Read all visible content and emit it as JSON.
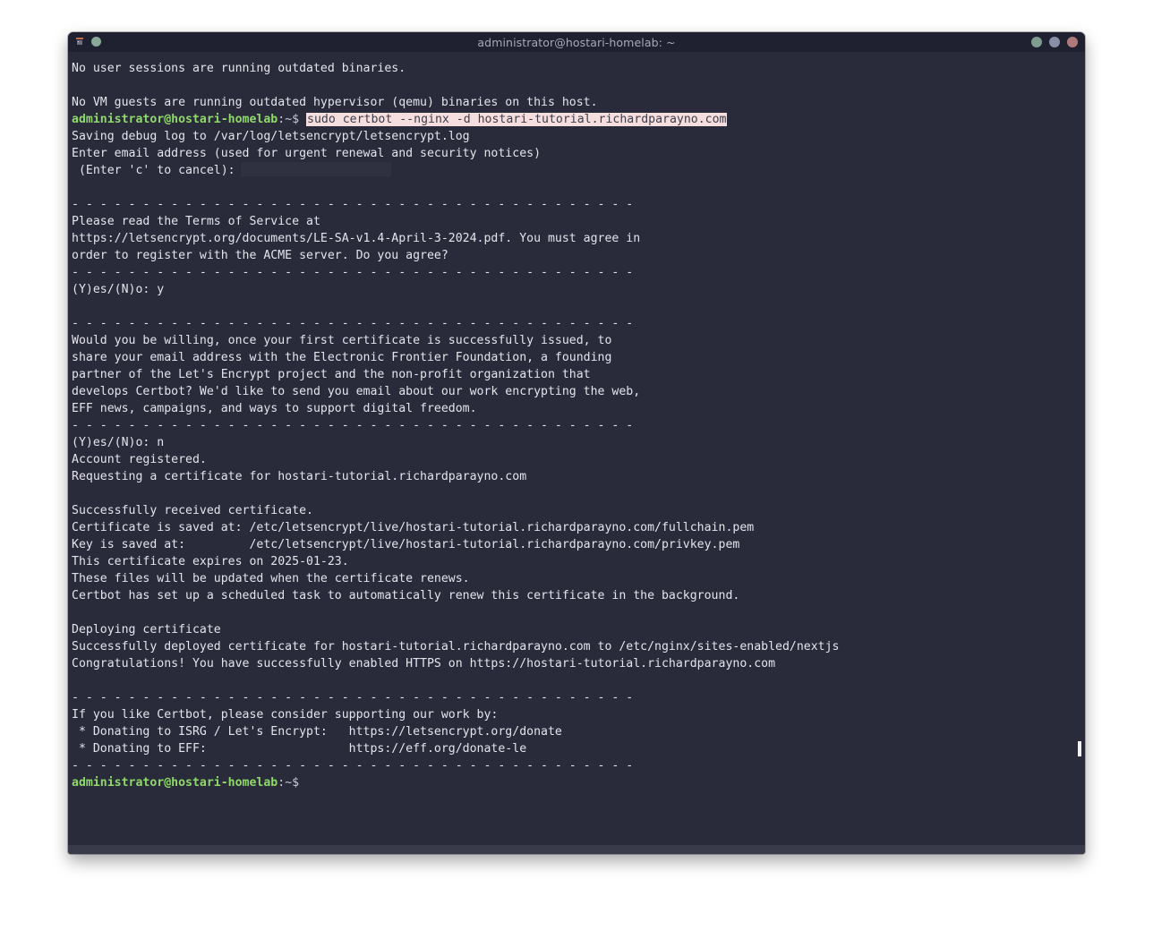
{
  "window": {
    "title": "administrator@hostari-homelab: ~"
  },
  "prompt": {
    "user_host": "administrator@hostari-homelab",
    "suffix": ":~$"
  },
  "colors": {
    "prompt_green": "#8fd96b",
    "terminal_bg": "#2a2b3a",
    "highlight_bg": "#f6dede"
  },
  "terminal": {
    "lines": [
      {
        "t": "No user sessions are running outdated binaries."
      },
      {
        "t": ""
      },
      {
        "t": "No VM guests are running outdated hypervisor (qemu) binaries on this host."
      },
      {
        "type": "prompt",
        "cmd": "sudo certbot --nginx -d hostari-tutorial.richardparayno.com"
      },
      {
        "t": "Saving debug log to /var/log/letsencrypt/letsencrypt.log"
      },
      {
        "t": "Enter email address (used for urgent renewal and security notices)"
      },
      {
        "type": "redacted",
        "t": " (Enter 'c' to cancel):"
      },
      {
        "t": ""
      },
      {
        "t": "- - - - - - - - - - - - - - - - - - - - - - - - - - - - - - - - - - - - - - - -"
      },
      {
        "t": "Please read the Terms of Service at"
      },
      {
        "t": "https://letsencrypt.org/documents/LE-SA-v1.4-April-3-2024.pdf. You must agree in"
      },
      {
        "t": "order to register with the ACME server. Do you agree?"
      },
      {
        "t": "- - - - - - - - - - - - - - - - - - - - - - - - - - - - - - - - - - - - - - - -"
      },
      {
        "t": "(Y)es/(N)o: y"
      },
      {
        "t": ""
      },
      {
        "t": "- - - - - - - - - - - - - - - - - - - - - - - - - - - - - - - - - - - - - - - -"
      },
      {
        "t": "Would you be willing, once your first certificate is successfully issued, to"
      },
      {
        "t": "share your email address with the Electronic Frontier Foundation, a founding"
      },
      {
        "t": "partner of the Let's Encrypt project and the non-profit organization that"
      },
      {
        "t": "develops Certbot? We'd like to send you email about our work encrypting the web,"
      },
      {
        "t": "EFF news, campaigns, and ways to support digital freedom."
      },
      {
        "t": "- - - - - - - - - - - - - - - - - - - - - - - - - - - - - - - - - - - - - - - -"
      },
      {
        "t": "(Y)es/(N)o: n"
      },
      {
        "t": "Account registered."
      },
      {
        "t": "Requesting a certificate for hostari-tutorial.richardparayno.com"
      },
      {
        "t": ""
      },
      {
        "t": "Successfully received certificate."
      },
      {
        "t": "Certificate is saved at: /etc/letsencrypt/live/hostari-tutorial.richardparayno.com/fullchain.pem"
      },
      {
        "t": "Key is saved at:         /etc/letsencrypt/live/hostari-tutorial.richardparayno.com/privkey.pem"
      },
      {
        "t": "This certificate expires on 2025-01-23."
      },
      {
        "t": "These files will be updated when the certificate renews."
      },
      {
        "t": "Certbot has set up a scheduled task to automatically renew this certificate in the background."
      },
      {
        "t": ""
      },
      {
        "t": "Deploying certificate"
      },
      {
        "t": "Successfully deployed certificate for hostari-tutorial.richardparayno.com to /etc/nginx/sites-enabled/nextjs"
      },
      {
        "t": "Congratulations! You have successfully enabled HTTPS on https://hostari-tutorial.richardparayno.com"
      },
      {
        "t": ""
      },
      {
        "t": "- - - - - - - - - - - - - - - - - - - - - - - - - - - - - - - - - - - - - - - -"
      },
      {
        "t": "If you like Certbot, please consider supporting our work by:"
      },
      {
        "t": " * Donating to ISRG / Let's Encrypt:   https://letsencrypt.org/donate"
      },
      {
        "t": " * Donating to EFF:                    https://eff.org/donate-le"
      },
      {
        "t": "- - - - - - - - - - - - - - - - - - - - - - - - - - - - - - - - - - - - - - - -"
      },
      {
        "type": "prompt",
        "cmd": ""
      }
    ]
  }
}
